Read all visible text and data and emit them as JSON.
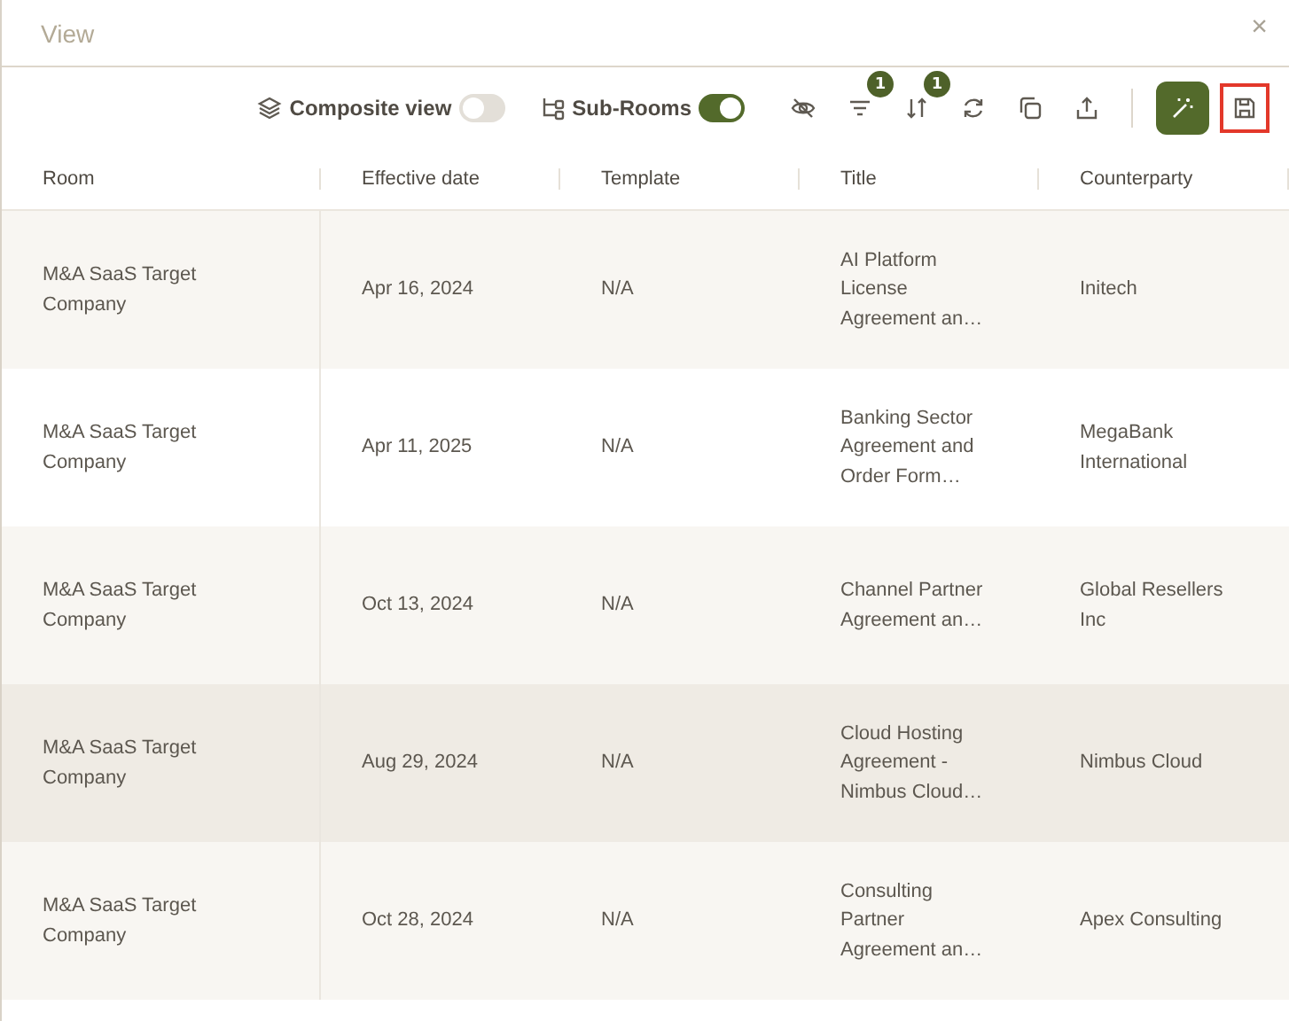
{
  "window": {
    "title": "View",
    "close": "×"
  },
  "toolbar": {
    "composite_view": {
      "label": "Composite view",
      "on": false
    },
    "sub_rooms": {
      "label": "Sub-Rooms",
      "on": true
    },
    "actions": [
      {
        "kind": "hide"
      },
      {
        "kind": "filter",
        "badge": "1"
      },
      {
        "kind": "sort",
        "badge": "1"
      },
      {
        "kind": "refresh"
      },
      {
        "kind": "copy"
      },
      {
        "kind": "share"
      },
      {
        "kind": "magic"
      },
      {
        "kind": "save",
        "highlighted": true
      }
    ]
  },
  "table": {
    "columns": [
      "Room",
      "Effective date",
      "Template",
      "Title",
      "Counterparty"
    ],
    "rows": [
      {
        "selected": false,
        "cells": [
          "M&A SaaS Target Company",
          "Apr 16, 2024",
          "N/A",
          "AI Platform License Agreement an…",
          "Initech"
        ]
      },
      {
        "selected": false,
        "cells": [
          "M&A SaaS Target Company",
          "Apr 11, 2025",
          "N/A",
          "Banking Sector Agreement and Order Form…",
          "MegaBank International"
        ]
      },
      {
        "selected": false,
        "cells": [
          "M&A SaaS Target Company",
          "Oct 13, 2024",
          "N/A",
          "Channel Partner Agreement an…",
          "Global Resellers Inc"
        ]
      },
      {
        "selected": true,
        "cells": [
          "M&A SaaS Target Company",
          "Aug 29, 2024",
          "N/A",
          "Cloud Hosting Agreement - Nimbus Cloud…",
          "Nimbus Cloud"
        ]
      },
      {
        "selected": false,
        "cells": [
          "M&A SaaS Target Company",
          "Oct 28, 2024",
          "N/A",
          "Consulting Partner Agreement an…",
          "Apex Consulting"
        ]
      }
    ]
  }
}
